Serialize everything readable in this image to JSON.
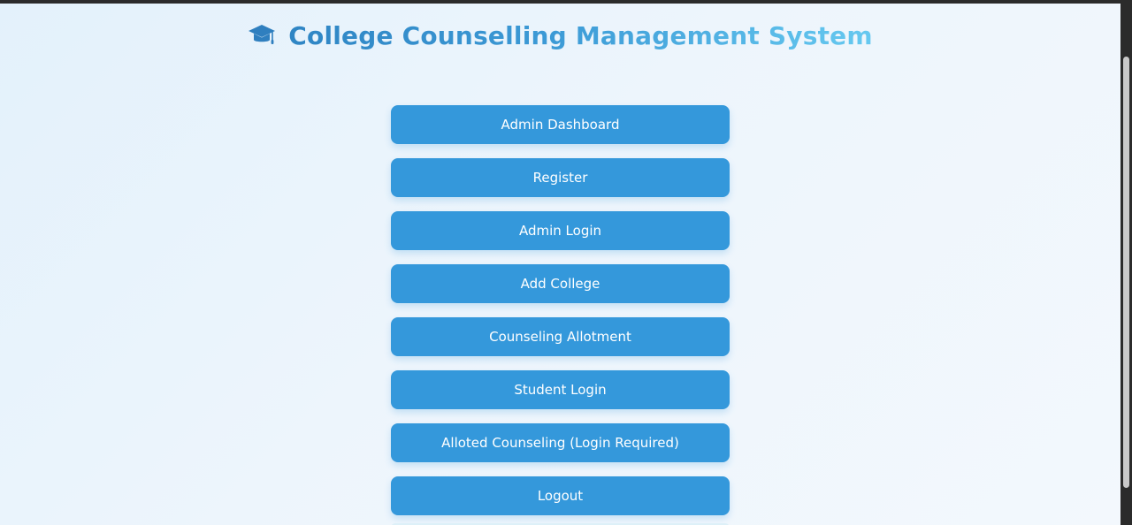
{
  "header": {
    "title": "College Counselling Management System",
    "icon": "graduation-cap-icon"
  },
  "menu": {
    "items": [
      {
        "label": "Admin Dashboard"
      },
      {
        "label": "Register"
      },
      {
        "label": "Admin Login"
      },
      {
        "label": "Add College"
      },
      {
        "label": "Counseling Allotment"
      },
      {
        "label": "Student Login"
      },
      {
        "label": "Alloted Counseling (Login Required)"
      },
      {
        "label": "Logout"
      }
    ]
  },
  "colors": {
    "button": "#3498db",
    "button_text": "#ffffff",
    "title_start": "#2f85c4",
    "title_end": "#66c9f0",
    "background": "#eaf4fc"
  }
}
